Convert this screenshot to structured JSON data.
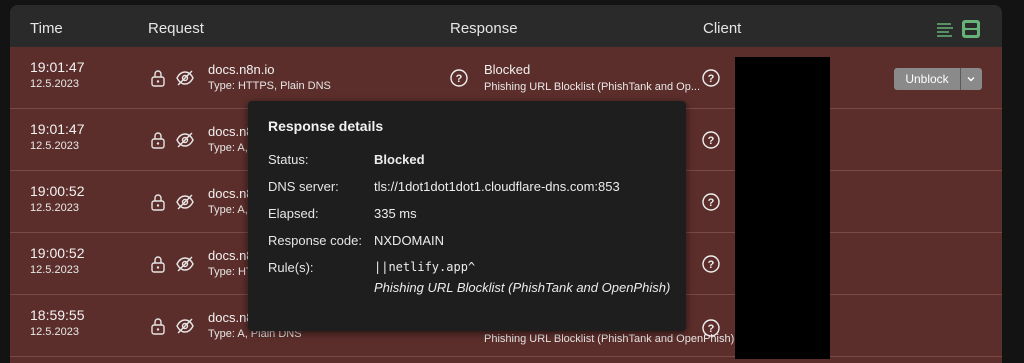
{
  "table": {
    "headers": {
      "time": "Time",
      "request": "Request",
      "response": "Response",
      "client": "Client"
    },
    "rows": [
      {
        "time": "19:01:47",
        "date": "12.5.2023",
        "host": "docs.n8n.io",
        "type": "Type: HTTPS, Plain DNS",
        "status": "Blocked",
        "list": "Phishing URL Blocklist (PhishTank and Op..."
      },
      {
        "time": "19:01:47",
        "date": "12.5.2023",
        "host": "docs.n8",
        "type": "Type: A,",
        "status": "",
        "list": ""
      },
      {
        "time": "19:00:52",
        "date": "12.5.2023",
        "host": "docs.n8",
        "type": "Type: A,",
        "status": "",
        "list": ""
      },
      {
        "time": "19:00:52",
        "date": "12.5.2023",
        "host": "docs.n8",
        "type": "Type: HTT",
        "status": "",
        "list": ""
      },
      {
        "time": "18:59:55",
        "date": "12.5.2023",
        "host": "docs.n8",
        "type": "Type: A, Plain DNS",
        "status": "",
        "list": "Phishing URL Blocklist (PhishTank and OpenPhish)"
      }
    ]
  },
  "unblock": {
    "label": "Unblock"
  },
  "tooltip": {
    "title": "Response details",
    "status_label": "Status:",
    "status_value": "Blocked",
    "dns_label": "DNS server:",
    "dns_value": "tls://1dot1dot1dot1.cloudflare-dns.com:853",
    "elapsed_label": "Elapsed:",
    "elapsed_value": "335 ms",
    "code_label": "Response code:",
    "code_value": "NXDOMAIN",
    "rules_label": "Rule(s):",
    "rule_text": "||netlify.app^",
    "rule_list": "Phishing URL Blocklist (PhishTank and OpenPhish)"
  },
  "colors": {
    "header_bg": "#2a2a2a",
    "row_bg": "#5c2e2b",
    "tooltip_bg": "#1e1e1e",
    "accent_green": "#67b279"
  },
  "icons": [
    "lock-icon",
    "eye-off-icon",
    "question-icon",
    "list-view-icon",
    "card-view-icon",
    "chevron-down-icon"
  ]
}
